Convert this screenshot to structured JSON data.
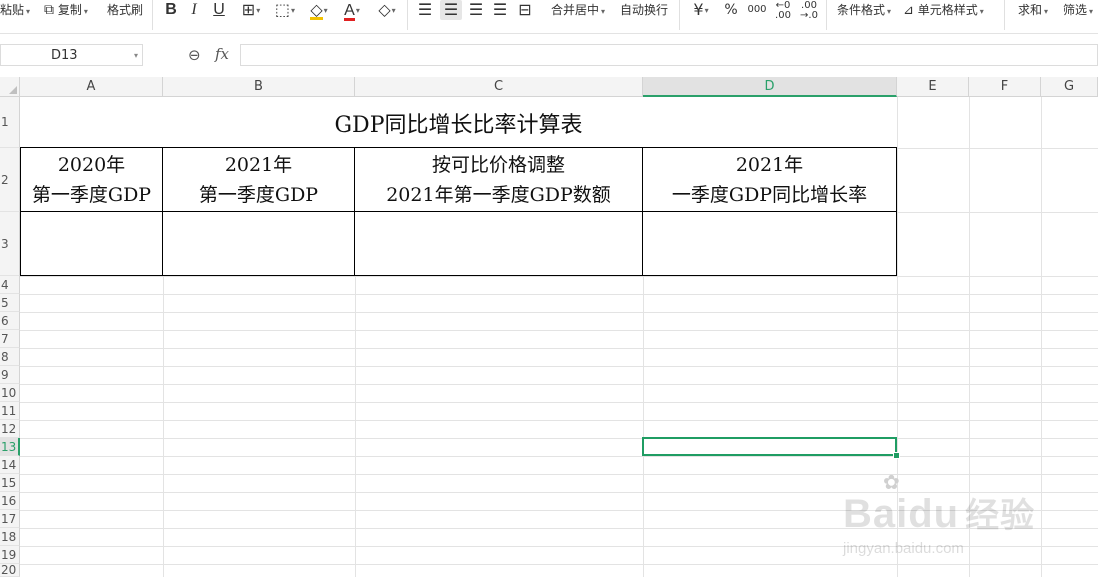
{
  "toolbar": {
    "paste": "粘贴",
    "copy": "复制",
    "format_painter": "格式刷",
    "bold": "B",
    "italic": "I",
    "underline": "U",
    "merge_center": "合并居中",
    "wrap_text": "自动换行",
    "currency": "¥",
    "percent": "%",
    "thousands": "000",
    "inc_decimal_top": "←0",
    "inc_decimal_bottom": ".00",
    "dec_decimal_top": ".00",
    "dec_decimal_bottom": "→.0",
    "conditional_format": "条件格式",
    "cell_style": "单元格样式",
    "sum": "求和",
    "filter": "筛选"
  },
  "formula_bar": {
    "name_box": "D13",
    "fx": "fx",
    "formula": ""
  },
  "columns": [
    "A",
    "B",
    "C",
    "D",
    "E",
    "F",
    "G"
  ],
  "selected_column": "D",
  "rows": [
    "1",
    "2",
    "3",
    "4",
    "5",
    "6",
    "7",
    "8",
    "9",
    "10",
    "11",
    "12",
    "13",
    "14",
    "15",
    "16",
    "17",
    "18",
    "19",
    "20"
  ],
  "selected_row": "13",
  "sheet": {
    "title": "GDP同比增长比率计算表",
    "headers": [
      {
        "line1": "2020年",
        "line2": "第一季度GDP"
      },
      {
        "line1": "2021年",
        "line2": "第一季度GDP"
      },
      {
        "line1": "按可比价格调整",
        "line2": "2021年第一季度GDP数额"
      },
      {
        "line1": "2021年",
        "line2": "一季度GDP同比增长率"
      }
    ],
    "data_row": [
      "",
      "",
      "",
      ""
    ]
  },
  "watermark": {
    "brand": "Bai",
    "brand_tail": "du",
    "brand_cn": "经验",
    "url": "jingyan.baidu.com"
  },
  "colors": {
    "selection": "#1f9d63",
    "grid": "#e3e3e3",
    "header_bg": "#f4f4f4"
  }
}
